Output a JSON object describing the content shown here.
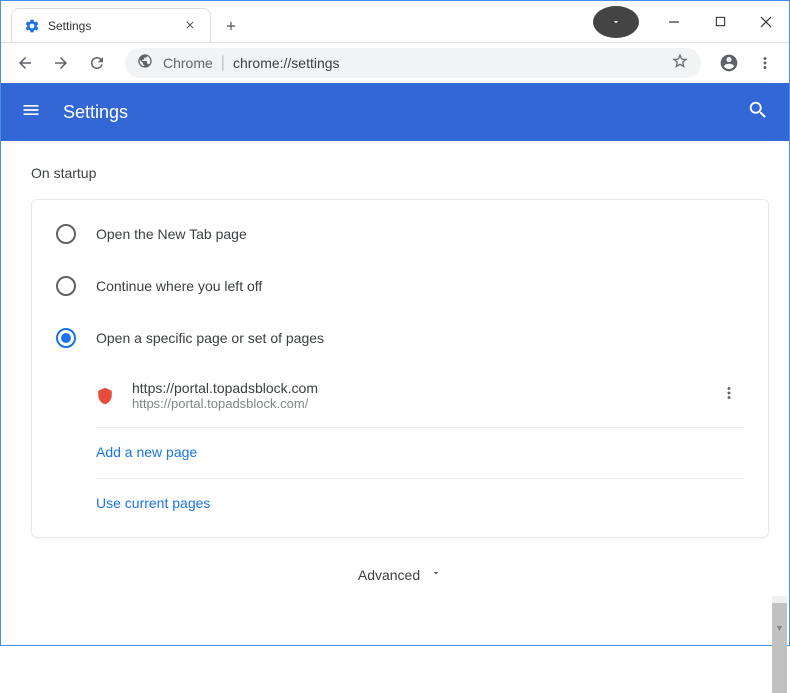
{
  "tab": {
    "title": "Settings"
  },
  "omnibox": {
    "prefix": "Chrome",
    "url": "chrome://settings"
  },
  "header": {
    "title": "Settings"
  },
  "section": {
    "title": "On startup"
  },
  "radios": [
    {
      "label": "Open the New Tab page",
      "selected": false
    },
    {
      "label": "Continue where you left off",
      "selected": false
    },
    {
      "label": "Open a specific page or set of pages",
      "selected": true
    }
  ],
  "startup_page": {
    "title": "https://portal.topadsblock.com",
    "url": "https://portal.topadsblock.com/"
  },
  "links": {
    "add_page": "Add a new page",
    "use_current": "Use current pages"
  },
  "advanced": {
    "label": "Advanced"
  }
}
